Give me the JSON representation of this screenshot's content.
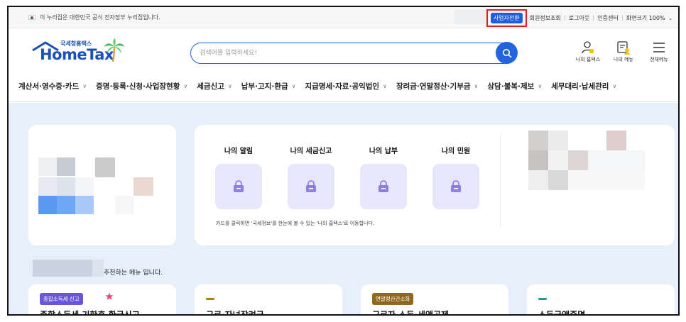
{
  "utility_bar": {
    "gov_notice": "이 누리집은 대한민국 공식 전자정부 누리집입니다.",
    "links": {
      "biz_switch": "사업자전환",
      "member_info": "회원정보조회",
      "logout": "로그아웃",
      "cert_center": "인증센터",
      "screen_size_label": "화면크기",
      "screen_size_value": "100%"
    }
  },
  "header": {
    "logo_kr": "국세청홈택스",
    "logo_en": "HomeTax",
    "search": {
      "placeholder": "검색어를 입력하세요!",
      "value": ""
    },
    "icons": [
      {
        "label": "나의 홈택스",
        "icon": "my-hometax-icon"
      },
      {
        "label": "나의 메뉴",
        "icon": "my-menu-icon"
      },
      {
        "label": "전체메뉴",
        "icon": "hamburger-icon"
      }
    ]
  },
  "nav": {
    "items": [
      "계산서·영수증·카드",
      "증명·등록·신청·사업장현황",
      "세금신고",
      "납부·고지·환급",
      "지급명세·자료·공익법인",
      "장려금·연말정산·기부금",
      "상담·불복·제보",
      "세무대리·납세관리"
    ]
  },
  "quick": {
    "items": [
      "나의 알림",
      "나의 세금신고",
      "나의 납부",
      "나의 민원"
    ],
    "note": "카드를 클릭하면 '국세정보'를 한눈에 볼 수 있는 '나의 홈택스'로 이동합니다."
  },
  "recommend": {
    "suffix": "추천하는 메뉴 입니다."
  },
  "bottom_cards": [
    {
      "badge": "종합소득세 신고",
      "title": "종합소득세 기한후 환급신고"
    },
    {
      "badge": "",
      "title": "근로·자녀장려금"
    },
    {
      "badge": "연말정산간소화",
      "title": "근로자 소득·세액공제"
    },
    {
      "badge": "",
      "title": "소득금액증명"
    }
  ],
  "colors": {
    "brand_blue": "#2463e0",
    "main_bg": "#e6effa",
    "quick_tile": "#e7e6fb",
    "lock_icon": "#8f7fe0",
    "highlight_border": "#e02020",
    "star": "#e84a7c"
  }
}
